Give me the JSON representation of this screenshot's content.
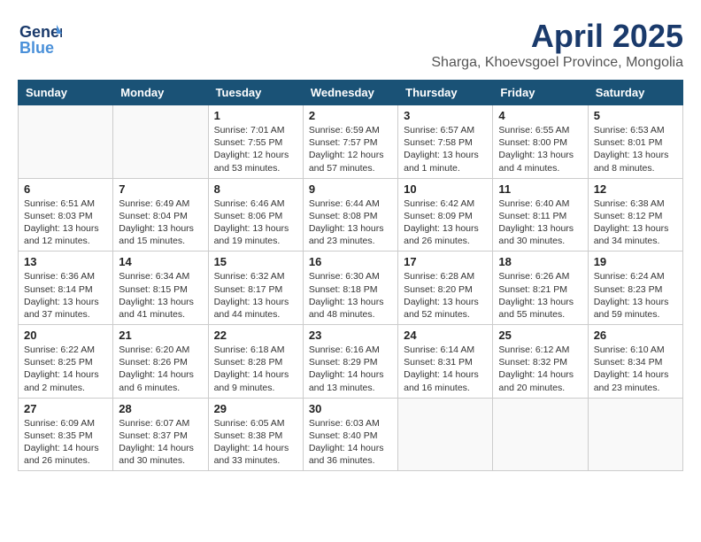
{
  "logo": {
    "line1": "General",
    "line2": "Blue"
  },
  "title": "April 2025",
  "location": "Sharga, Khoevsgoel Province, Mongolia",
  "days_of_week": [
    "Sunday",
    "Monday",
    "Tuesday",
    "Wednesday",
    "Thursday",
    "Friday",
    "Saturday"
  ],
  "weeks": [
    [
      {
        "day": "",
        "info": ""
      },
      {
        "day": "",
        "info": ""
      },
      {
        "day": "1",
        "info": "Sunrise: 7:01 AM\nSunset: 7:55 PM\nDaylight: 12 hours and 53 minutes."
      },
      {
        "day": "2",
        "info": "Sunrise: 6:59 AM\nSunset: 7:57 PM\nDaylight: 12 hours and 57 minutes."
      },
      {
        "day": "3",
        "info": "Sunrise: 6:57 AM\nSunset: 7:58 PM\nDaylight: 13 hours and 1 minute."
      },
      {
        "day": "4",
        "info": "Sunrise: 6:55 AM\nSunset: 8:00 PM\nDaylight: 13 hours and 4 minutes."
      },
      {
        "day": "5",
        "info": "Sunrise: 6:53 AM\nSunset: 8:01 PM\nDaylight: 13 hours and 8 minutes."
      }
    ],
    [
      {
        "day": "6",
        "info": "Sunrise: 6:51 AM\nSunset: 8:03 PM\nDaylight: 13 hours and 12 minutes."
      },
      {
        "day": "7",
        "info": "Sunrise: 6:49 AM\nSunset: 8:04 PM\nDaylight: 13 hours and 15 minutes."
      },
      {
        "day": "8",
        "info": "Sunrise: 6:46 AM\nSunset: 8:06 PM\nDaylight: 13 hours and 19 minutes."
      },
      {
        "day": "9",
        "info": "Sunrise: 6:44 AM\nSunset: 8:08 PM\nDaylight: 13 hours and 23 minutes."
      },
      {
        "day": "10",
        "info": "Sunrise: 6:42 AM\nSunset: 8:09 PM\nDaylight: 13 hours and 26 minutes."
      },
      {
        "day": "11",
        "info": "Sunrise: 6:40 AM\nSunset: 8:11 PM\nDaylight: 13 hours and 30 minutes."
      },
      {
        "day": "12",
        "info": "Sunrise: 6:38 AM\nSunset: 8:12 PM\nDaylight: 13 hours and 34 minutes."
      }
    ],
    [
      {
        "day": "13",
        "info": "Sunrise: 6:36 AM\nSunset: 8:14 PM\nDaylight: 13 hours and 37 minutes."
      },
      {
        "day": "14",
        "info": "Sunrise: 6:34 AM\nSunset: 8:15 PM\nDaylight: 13 hours and 41 minutes."
      },
      {
        "day": "15",
        "info": "Sunrise: 6:32 AM\nSunset: 8:17 PM\nDaylight: 13 hours and 44 minutes."
      },
      {
        "day": "16",
        "info": "Sunrise: 6:30 AM\nSunset: 8:18 PM\nDaylight: 13 hours and 48 minutes."
      },
      {
        "day": "17",
        "info": "Sunrise: 6:28 AM\nSunset: 8:20 PM\nDaylight: 13 hours and 52 minutes."
      },
      {
        "day": "18",
        "info": "Sunrise: 6:26 AM\nSunset: 8:21 PM\nDaylight: 13 hours and 55 minutes."
      },
      {
        "day": "19",
        "info": "Sunrise: 6:24 AM\nSunset: 8:23 PM\nDaylight: 13 hours and 59 minutes."
      }
    ],
    [
      {
        "day": "20",
        "info": "Sunrise: 6:22 AM\nSunset: 8:25 PM\nDaylight: 14 hours and 2 minutes."
      },
      {
        "day": "21",
        "info": "Sunrise: 6:20 AM\nSunset: 8:26 PM\nDaylight: 14 hours and 6 minutes."
      },
      {
        "day": "22",
        "info": "Sunrise: 6:18 AM\nSunset: 8:28 PM\nDaylight: 14 hours and 9 minutes."
      },
      {
        "day": "23",
        "info": "Sunrise: 6:16 AM\nSunset: 8:29 PM\nDaylight: 14 hours and 13 minutes."
      },
      {
        "day": "24",
        "info": "Sunrise: 6:14 AM\nSunset: 8:31 PM\nDaylight: 14 hours and 16 minutes."
      },
      {
        "day": "25",
        "info": "Sunrise: 6:12 AM\nSunset: 8:32 PM\nDaylight: 14 hours and 20 minutes."
      },
      {
        "day": "26",
        "info": "Sunrise: 6:10 AM\nSunset: 8:34 PM\nDaylight: 14 hours and 23 minutes."
      }
    ],
    [
      {
        "day": "27",
        "info": "Sunrise: 6:09 AM\nSunset: 8:35 PM\nDaylight: 14 hours and 26 minutes."
      },
      {
        "day": "28",
        "info": "Sunrise: 6:07 AM\nSunset: 8:37 PM\nDaylight: 14 hours and 30 minutes."
      },
      {
        "day": "29",
        "info": "Sunrise: 6:05 AM\nSunset: 8:38 PM\nDaylight: 14 hours and 33 minutes."
      },
      {
        "day": "30",
        "info": "Sunrise: 6:03 AM\nSunset: 8:40 PM\nDaylight: 14 hours and 36 minutes."
      },
      {
        "day": "",
        "info": ""
      },
      {
        "day": "",
        "info": ""
      },
      {
        "day": "",
        "info": ""
      }
    ]
  ]
}
